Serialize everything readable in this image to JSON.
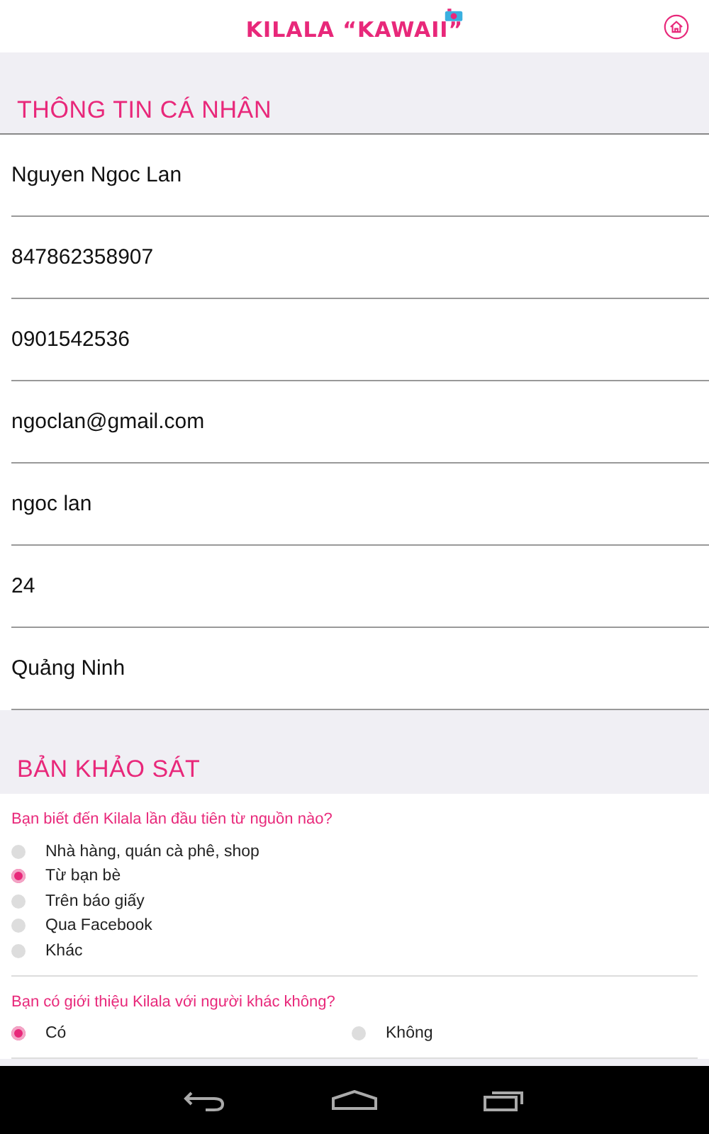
{
  "header": {
    "logo": "KILALA “KAWAII”"
  },
  "sections": [
    {
      "title": "THÔNG TIN CÁ NHÂN"
    },
    {
      "title": "BẢN KHẢO SÁT"
    }
  ],
  "fields": [
    {
      "value": "Nguyen Ngoc Lan"
    },
    {
      "value": "847862358907"
    },
    {
      "value": "0901542536"
    },
    {
      "value": "ngoclan@gmail.com"
    },
    {
      "value": "ngoc lan"
    },
    {
      "value": "24"
    },
    {
      "value": "Quảng Ninh"
    }
  ],
  "questions": [
    {
      "text": "Bạn biết đến Kilala lần đầu tiên từ nguồn nào?",
      "kind": "list",
      "options": [
        {
          "label": "Nhà hàng, quán cà phê, shop",
          "selected": false
        },
        {
          "label": "Từ bạn bè",
          "selected": true
        },
        {
          "label": "Trên báo giấy",
          "selected": false
        },
        {
          "label": "Qua Facebook",
          "selected": false
        },
        {
          "label": "Khác",
          "selected": false
        }
      ]
    },
    {
      "text": "Bạn có giới thiệu Kilala với người khác không?",
      "kind": "inline",
      "options": [
        {
          "label": "Có",
          "selected": true
        },
        {
          "label": "Không",
          "selected": false
        }
      ]
    }
  ]
}
